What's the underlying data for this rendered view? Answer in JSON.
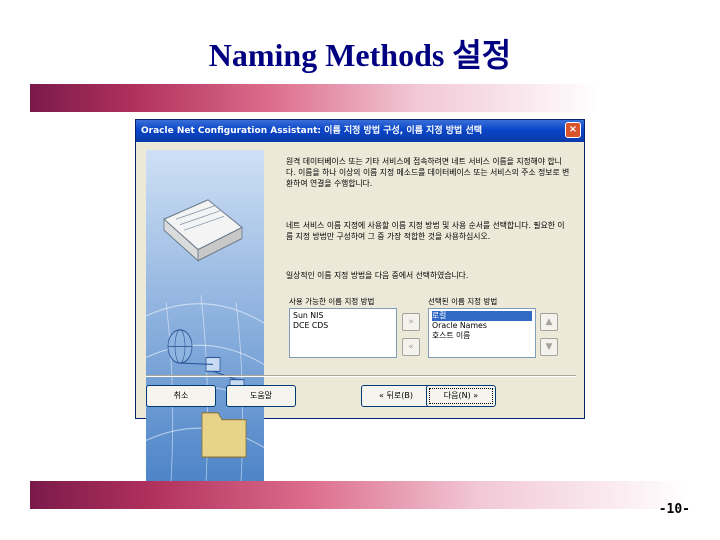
{
  "slide": {
    "title": "Naming Methods 설정",
    "page_number": "-10-"
  },
  "dialog": {
    "title": "Oracle Net Configuration Assistant: 이름 지정 방법 구성, 이름 지정 방법 선택",
    "close_icon": "×",
    "paragraph1": "원격 데이터베이스 또는 기타 서비스에 접속하려면 네트 서비스 이름을 지정해야 합니다. 이름을 하나 이상의 이름 지정 메소드를 데이터베이스 또는 서비스의 주소 정보로 변환하여 연결을 수행합니다.",
    "paragraph2": "네트 서비스 이름 지정에 사용할 이름 지정 방법 및 사용 순서를 선택합니다. 필요한 이름 지정 방법만 구성하여 그 중 가장 적합한 것을 사용하십시오.",
    "paragraph3": "일상적인 이름 지정 방법을 다음 중에서 선택하였습니다.",
    "available_label": "사용 가능한 이름 지정 방법",
    "selected_label": "선택된 이름 지정 방법",
    "available_items": [
      "Sun NIS",
      "DCE CDS"
    ],
    "selected_items": [
      "로컬",
      "Oracle Names",
      "호스트 이름"
    ],
    "arrow_add": "»",
    "arrow_remove": "«",
    "arrow_up": "▲",
    "arrow_down": "▼",
    "buttons": {
      "cancel": "취소",
      "help": "도움말",
      "back": "« 뒤로(B)",
      "next": "다음(N) »"
    }
  }
}
